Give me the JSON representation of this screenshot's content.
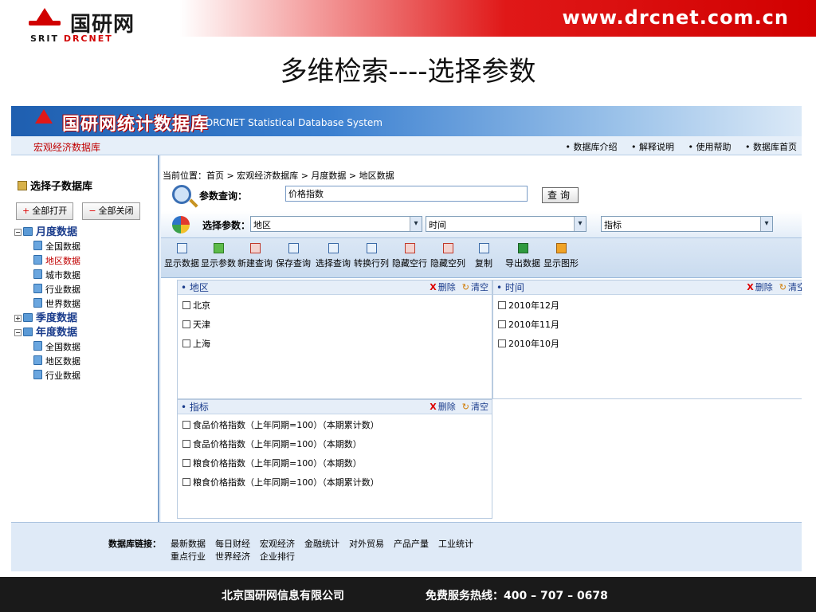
{
  "slide": {
    "logo_cn": "国研网",
    "logo_en_a": "SRIT ",
    "logo_en_b": "DRCNET",
    "url": "www.drcnet.com.cn",
    "title": "多维检索----选择参数"
  },
  "app": {
    "title_cn": "国研网统计数据库",
    "title_en": "DRCNET Statistical Database System",
    "section": "宏观经济数据库",
    "nav_links": [
      "• 数据库介绍",
      "• 解释说明",
      "• 使用帮助",
      "• 数据库首页"
    ]
  },
  "sidebar": {
    "header": "选择子数据库",
    "open_all": "全部打开",
    "close_all": "全部关闭",
    "tree": [
      {
        "label": "月度数据",
        "expander": "−",
        "children": [
          {
            "label": "全国数据",
            "active": false
          },
          {
            "label": "地区数据",
            "active": true
          },
          {
            "label": "城市数据",
            "active": false
          },
          {
            "label": "行业数据",
            "active": false
          },
          {
            "label": "世界数据",
            "active": false
          }
        ]
      },
      {
        "label": "季度数据",
        "expander": "+",
        "children": []
      },
      {
        "label": "年度数据",
        "expander": "−",
        "children": [
          {
            "label": "全国数据",
            "active": false
          },
          {
            "label": "地区数据",
            "active": false
          },
          {
            "label": "行业数据",
            "active": false
          }
        ]
      }
    ]
  },
  "main": {
    "breadcrumb": "当前位置：首页 > 宏观经济数据库 > 月度数据 > 地区数据",
    "query_label": "参数查询：",
    "query_value": "价格指数",
    "query_button": "查询",
    "param_label": "选择参数：",
    "selects": [
      "地区",
      "时间",
      "指标"
    ],
    "toolbar": [
      {
        "label": "显示数据",
        "cls": ""
      },
      {
        "label": "显示参数",
        "cls": "green"
      },
      {
        "label": "新建查询",
        "cls": "red"
      },
      {
        "label": "保存查询",
        "cls": ""
      },
      {
        "label": "选择查询",
        "cls": ""
      },
      {
        "label": "转换行列",
        "cls": ""
      },
      {
        "label": "隐藏空行",
        "cls": "red"
      },
      {
        "label": "隐藏空列",
        "cls": "red"
      },
      {
        "label": "复制",
        "cls": ""
      },
      {
        "label": "导出数据",
        "cls": "excel"
      },
      {
        "label": "显示图形",
        "cls": "chart"
      }
    ],
    "panels": {
      "delete": "删除",
      "clear": "清空",
      "region": {
        "title": "• 地区",
        "items": [
          "北京",
          "天津",
          "上海"
        ]
      },
      "time": {
        "title": "• 时间",
        "items": [
          "2010年12月",
          "2010年11月",
          "2010年10月"
        ]
      },
      "indicator": {
        "title": "• 指标",
        "items": [
          "食品价格指数（上年同期=100）（本期累计数）",
          "食品价格指数（上年同期=100）（本期数）",
          "粮食价格指数（上年同期=100）（本期数）",
          "粮食价格指数（上年同期=100）（本期累计数）"
        ]
      }
    }
  },
  "footer": {
    "label": "数据库链接：",
    "links": [
      "最新数据",
      "每日财经",
      "宏观经济",
      "金融统计",
      "对外贸易",
      "产品产量",
      "工业统计",
      "重点行业",
      "世界经济",
      "企业排行"
    ]
  },
  "bottom": {
    "company": "北京国研网信息有限公司",
    "hotline": "免费服务热线：400 – 707 – 0678"
  }
}
